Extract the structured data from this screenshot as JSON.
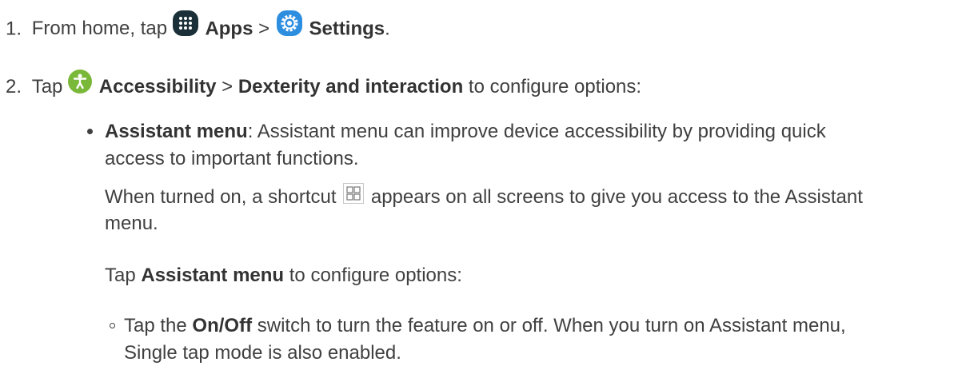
{
  "step1": {
    "number": "1.",
    "text_a": "From home, tap",
    "apps_icon": "apps-grid-icon",
    "apps_label": "Apps",
    "sep": ">",
    "settings_icon": "settings-gear-icon",
    "settings_label": "Settings",
    "period": "."
  },
  "step2": {
    "number": "2.",
    "text_a": "Tap",
    "accessibility_icon": "accessibility-icon",
    "accessibility_label": "Accessibility",
    "sep": ">",
    "dexterity_label": "Dexterity and interaction",
    "text_b": "to configure options:"
  },
  "bullet1": {
    "title": "Assistant menu",
    "desc_1": ": Assistant menu can improve device accessibility by providing quick",
    "desc_2": "access to important functions.",
    "shortcut_1": "When turned on, a shortcut",
    "shortcut_icon": "assistant-menu-shortcut-icon",
    "shortcut_2": "appears on all screens to give you access to the Assistant",
    "shortcut_3": "menu.",
    "tap_a": "Tap",
    "tap_label": "Assistant menu",
    "tap_b": "to configure options:"
  },
  "sub1": {
    "text_a": "Tap the",
    "onoff_label": "On/Off",
    "text_b": "switch to turn the feature on or off. When you turn on Assistant menu,",
    "text_c": "Single tap mode is also enabled."
  },
  "colors": {
    "text": "#404040",
    "apps_icon": "#1a2f38",
    "settings_icon": "#2d8ee0",
    "accessibility_icon": "#7ab83a"
  }
}
